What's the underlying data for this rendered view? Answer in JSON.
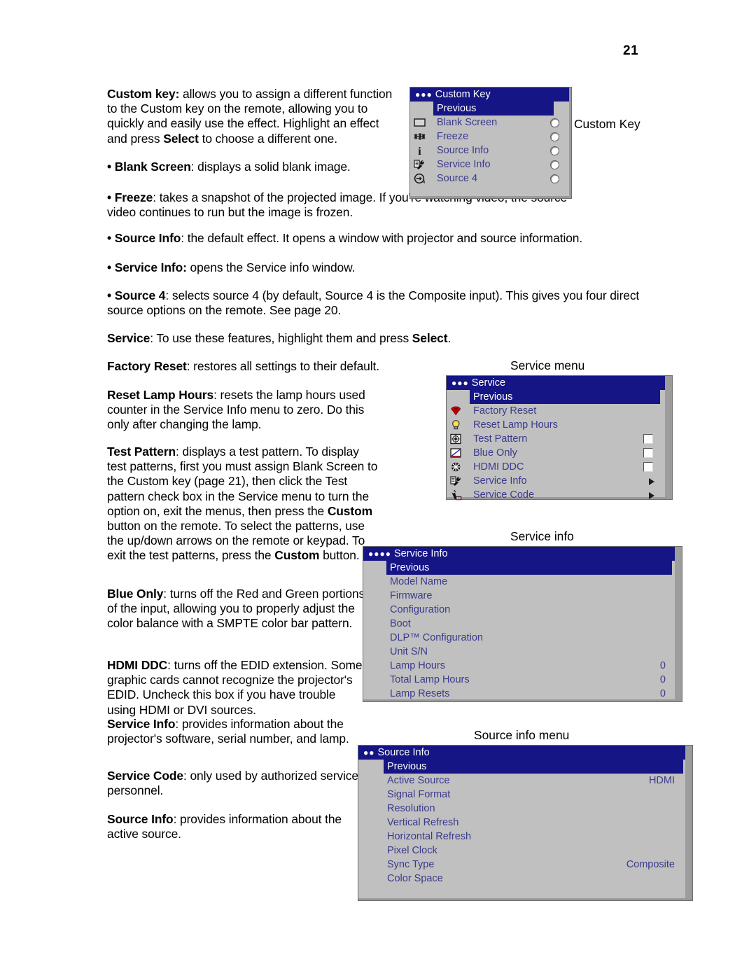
{
  "page": {
    "number": "21"
  },
  "body": {
    "p_custom_key": "Custom key: allows you to assign a different function to the Custom key on the remote, allowing you to quickly and easily use the effect. Highlight an effect and press Select to choose a different one.",
    "p_custom_key_parts": {
      "b1": "Custom key:",
      "t1": " allows you to assign a different function to the Custom key on the remote, allowing you to quickly and easily use the effect. Highlight an effect and press ",
      "b2": "Select",
      "t2": " to choose a different one."
    },
    "p_blank_screen_b": "• Blank Screen",
    "p_blank_screen_t": ": displays a solid blank image.",
    "p_freeze_b": "• Freeze",
    "p_freeze_t": ": takes a snapshot of the projected image. If you're watching video, the source video continues to run but the image is frozen.",
    "p_source_info_b": "• Source Info",
    "p_source_info_t": ": the default effect. It opens a window with projector and source information.",
    "p_service_info_b": "• Service Info:",
    "p_service_info_t": " opens the Service info window.",
    "p_source4_b": "• Source 4",
    "p_source4_t": ": selects source 4 (by default, Source 4 is the Composite input). This gives you four direct source options on the remote. See page 20.",
    "p_service_b": "Service",
    "p_service_t1": ": To use these features, highlight them and press ",
    "p_service_b2": "Select",
    "p_service_t2": ".",
    "p_factory_reset_b": "Factory Reset",
    "p_factory_reset_t": ": restores all settings to their default.",
    "p_reset_lamp_b": "Reset Lamp Hours",
    "p_reset_lamp_t": ": resets the lamp hours used counter in the Service Info menu to zero. Do this only after changing the lamp.",
    "p_test_pattern_b": "Test Pattern",
    "p_test_pattern_t1": ": displays a test pattern. To display test patterns, first you must assign Blank Screen to the Custom key (page 21), then click the Test pattern check box in the Service menu to turn the option on, exit the menus, then press the ",
    "p_test_pattern_b2": "Custom",
    "p_test_pattern_t2": " button on the remote. To select the patterns, use the up/down arrows on the remote or keypad. To exit the test patterns, press the ",
    "p_test_pattern_b3": "Custom",
    "p_test_pattern_t3": " button.",
    "p_blue_only_b": "Blue Only",
    "p_blue_only_t": ": turns off the Red and Green portions of the input, allowing you to properly adjust the color balance with a SMPTE color bar pattern.",
    "p_hdmi_ddc_b": "HDMI DDC",
    "p_hdmi_ddc_t": ": turns off the EDID extension. Some graphic cards cannot recognize the projector's EDID. Uncheck this box if you have trouble using HDMI or DVI sources.",
    "p_service_info2_b": "Service Info",
    "p_service_info2_t": ": provides information about the projector's software, serial number, and lamp.",
    "p_service_code_b": "Service Code",
    "p_service_code_t": ": only used by authorized service personnel.",
    "p_source_info2_b": "Source Info",
    "p_source_info2_t": ": provides information about the active source."
  },
  "captions": {
    "custom_key": "Custom Key",
    "service_menu": "Service menu",
    "service_info": "Service info",
    "source_info_menu": "Source info menu"
  },
  "custom_key_menu": {
    "title": "Custom Key",
    "dots": "●●●",
    "items": [
      {
        "label": "Previous",
        "selected": true,
        "icon": "",
        "control": "none"
      },
      {
        "label": "Blank Screen",
        "selected": false,
        "icon": "blank-screen-icon",
        "control": "radio"
      },
      {
        "label": "Freeze",
        "selected": false,
        "icon": "freeze-snowflake-icon",
        "control": "radio"
      },
      {
        "label": "Source Info",
        "selected": false,
        "icon": "info-icon",
        "control": "radio"
      },
      {
        "label": "Service Info",
        "selected": false,
        "icon": "service-wrench-icon",
        "control": "radio"
      },
      {
        "label": "Source 4",
        "selected": false,
        "icon": "source-input-icon",
        "control": "radio"
      }
    ]
  },
  "service_menu": {
    "title": "Service",
    "dots": "●●●",
    "items": [
      {
        "label": "Previous",
        "selected": true,
        "icon": "",
        "control": "none"
      },
      {
        "label": "Factory Reset",
        "selected": false,
        "icon": "factory-reset-icon",
        "control": "none"
      },
      {
        "label": "Reset Lamp Hours",
        "selected": false,
        "icon": "lamp-bulb-icon",
        "control": "none"
      },
      {
        "label": "Test Pattern",
        "selected": false,
        "icon": "test-pattern-icon",
        "control": "checkbox"
      },
      {
        "label": "Blue Only",
        "selected": false,
        "icon": "blue-only-icon",
        "control": "checkbox"
      },
      {
        "label": "HDMI DDC",
        "selected": false,
        "icon": "hdmi-ddc-icon",
        "control": "checkbox"
      },
      {
        "label": "Service Info",
        "selected": false,
        "icon": "service-wrench-icon",
        "control": "arrow"
      },
      {
        "label": "Service Code",
        "selected": false,
        "icon": "service-code-icon",
        "control": "arrow"
      }
    ]
  },
  "service_info_menu": {
    "title": "Service Info",
    "dots": "●●●●",
    "items": [
      {
        "label": "Previous",
        "value": "",
        "selected": true
      },
      {
        "label": "Model Name",
        "value": "",
        "selected": false
      },
      {
        "label": "Firmware",
        "value": "",
        "selected": false
      },
      {
        "label": "Configuration",
        "value": "",
        "selected": false
      },
      {
        "label": "Boot",
        "value": "",
        "selected": false
      },
      {
        "label": "DLP™ Configuration",
        "value": "",
        "selected": false
      },
      {
        "label": "Unit S/N",
        "value": "",
        "selected": false
      },
      {
        "label": "Lamp Hours",
        "value": "0",
        "selected": false
      },
      {
        "label": "Total Lamp Hours",
        "value": "0",
        "selected": false
      },
      {
        "label": "Lamp Resets",
        "value": "0",
        "selected": false
      }
    ]
  },
  "source_info_menu": {
    "title": "Source Info",
    "dots": "●●",
    "items": [
      {
        "label": "Previous",
        "value": "",
        "selected": true
      },
      {
        "label": "Active Source",
        "value": "HDMI",
        "selected": false
      },
      {
        "label": "Signal Format",
        "value": "",
        "selected": false
      },
      {
        "label": "Resolution",
        "value": "",
        "selected": false
      },
      {
        "label": "Vertical Refresh",
        "value": "",
        "selected": false
      },
      {
        "label": "Horizontal Refresh",
        "value": "",
        "selected": false
      },
      {
        "label": "Pixel Clock",
        "value": "",
        "selected": false
      },
      {
        "label": "Sync Type",
        "value": "",
        "selected": false
      },
      {
        "label": "Color Space",
        "value": "",
        "selected": false
      }
    ],
    "sync_type_value": "Composite"
  },
  "colors": {
    "menu_bg": "#c0c0c0",
    "menu_title_bg": "#151586",
    "menu_text": "#3a3a8c",
    "selected_bg": "#151586",
    "selected_text": "#ffffff"
  }
}
